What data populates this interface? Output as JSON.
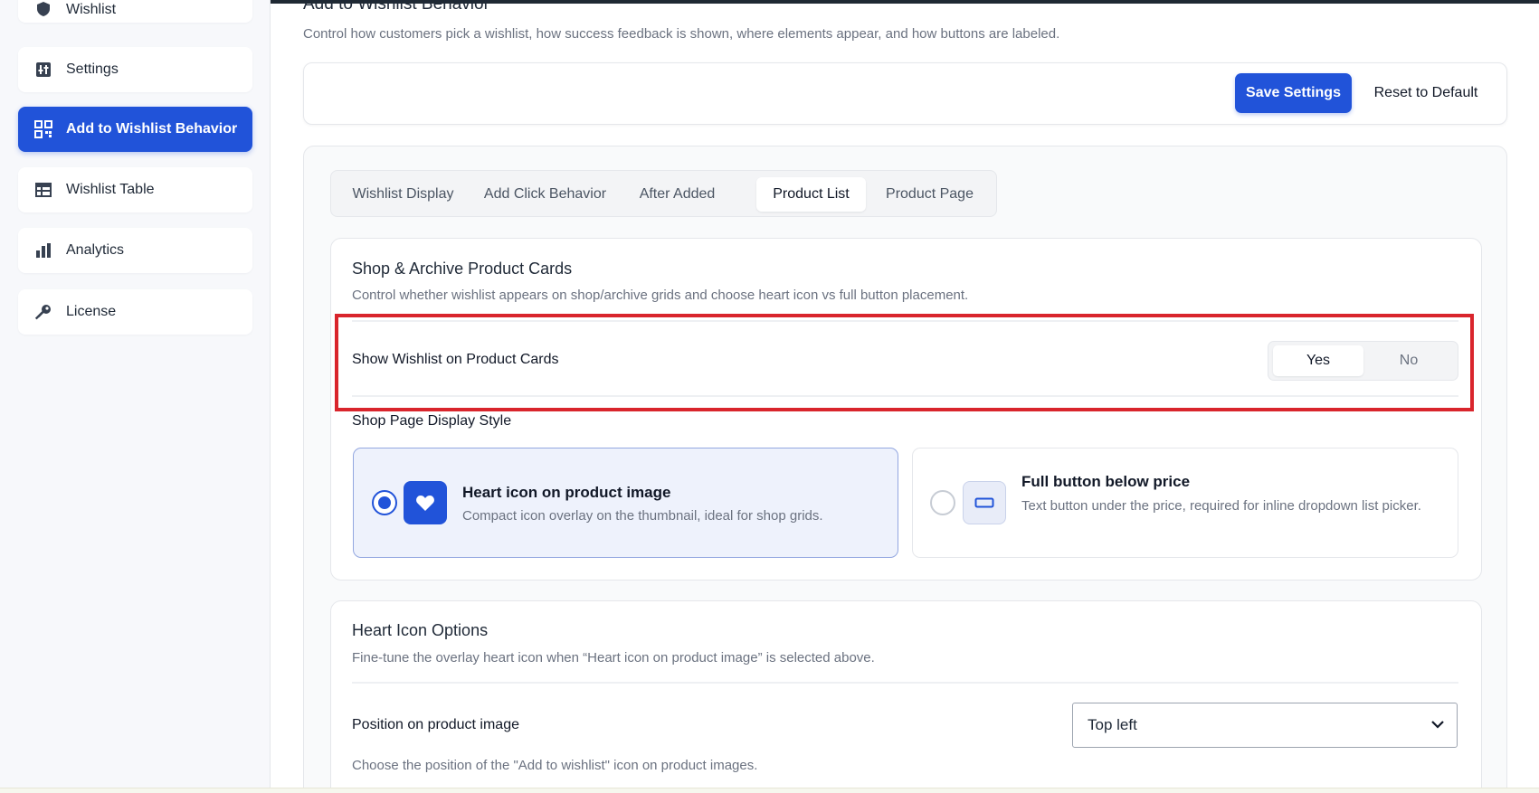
{
  "sidebar": {
    "items": [
      {
        "label": "Wishlist",
        "icon": "shield-icon"
      },
      {
        "label": "Settings",
        "icon": "settings-chart-icon"
      },
      {
        "label": "Add to Wishlist Behavior",
        "icon": "grid-icon",
        "active": true
      },
      {
        "label": "Wishlist Table",
        "icon": "table-icon"
      },
      {
        "label": "Analytics",
        "icon": "bar-chart-icon"
      },
      {
        "label": "License",
        "icon": "key-icon"
      }
    ]
  },
  "header": {
    "title": "Add to Wishlist Behavior",
    "description": "Control how customers pick a wishlist, how success feedback is shown, where elements appear, and how buttons are labeled."
  },
  "actions": {
    "save_label": "Save Settings",
    "reset_label": "Reset to Default"
  },
  "tabs": [
    {
      "label": "Wishlist Display"
    },
    {
      "label": "Add Click Behavior"
    },
    {
      "label": "After Added"
    },
    {
      "label": "Product List",
      "active": true
    },
    {
      "label": "Product Page"
    }
  ],
  "shop_cards": {
    "title": "Shop & Archive Product Cards",
    "description": "Control whether wishlist appears on shop/archive grids and choose heart icon vs full button placement.",
    "show_label": "Show Wishlist on Product Cards",
    "toggle": {
      "yes": "Yes",
      "no": "No",
      "selected": "Yes"
    },
    "style_label": "Shop Page Display Style",
    "options": [
      {
        "title": "Heart icon on product image",
        "description": "Compact icon overlay on the thumbnail, ideal for shop grids.",
        "selected": true,
        "icon": "heart-icon"
      },
      {
        "title": "Full button below price",
        "description": "Text button under the price, required for inline dropdown list picker.",
        "selected": false,
        "icon": "button-icon"
      }
    ]
  },
  "heart_options": {
    "title": "Heart Icon Options",
    "description": "Fine-tune the overlay heart icon when “Heart icon on product image” is selected above.",
    "position_label": "Position on product image",
    "position_value": "Top left",
    "position_help": "Choose the position of the \"Add to wishlist\" icon on product images."
  },
  "colors": {
    "accent": "#2153d9",
    "highlight": "#d9252c"
  }
}
